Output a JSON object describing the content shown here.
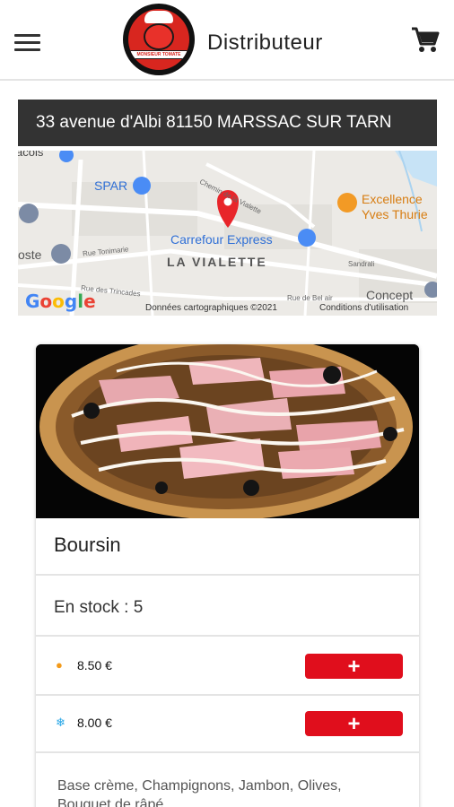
{
  "header": {
    "title": "Distributeur",
    "logo_text": "MONSIEUR TOMATE",
    "menu_icon": "hamburger-menu-icon",
    "cart_icon": "shopping-cart-icon"
  },
  "address": "33 avenue d'Albi 81150 MARSSAC SUR TARN",
  "map": {
    "labels": {
      "acois": "acois",
      "spar": "SPAR",
      "chemin": "Chemin de la Vialette",
      "excellence_1": "Excellence",
      "excellence_2": "Yves Thurie",
      "oste": "oste",
      "rue_tonimarie": "Rue Tonimarie",
      "carrefour": "Carrefour Express",
      "la_vialette": "LA VIALETTE",
      "sandrali": "Sandrali",
      "rue_trincades": "Rue des Trincades",
      "bel_air": "Rue de Bel air",
      "concept": "Concept"
    },
    "google": [
      "G",
      "o",
      "o",
      "g",
      "l",
      "e"
    ],
    "attribution": "Données cartographiques ©2021",
    "terms": "Conditions d'utilisation",
    "pin_color": "#e8252a"
  },
  "product": {
    "name": "Boursin",
    "stock": "En stock : 5",
    "prices": [
      {
        "icon": "flame-icon",
        "glyph": "🔥",
        "value": "8.50  €",
        "button": "+"
      },
      {
        "icon": "snowflake-icon",
        "glyph": "❄",
        "value": "8.00  €",
        "button": "+"
      }
    ],
    "description": "Base crème, Champignons, Jambon, Olives, Bouquet de râpé"
  },
  "colors": {
    "accent": "#e00e1c",
    "address_bg": "#333333"
  }
}
